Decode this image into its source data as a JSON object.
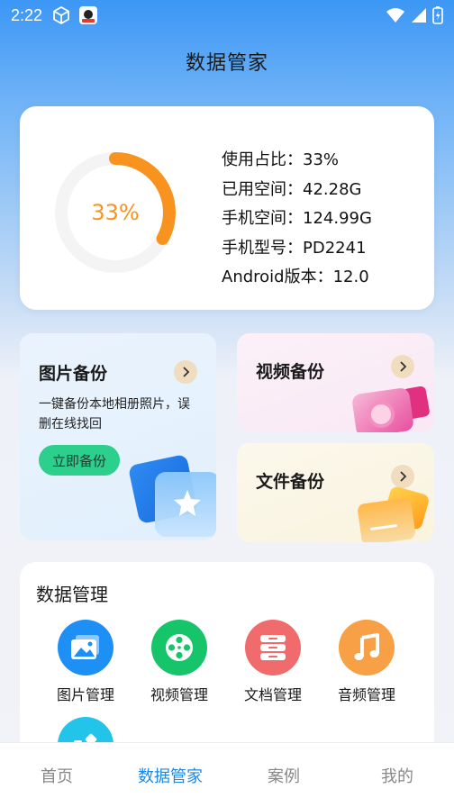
{
  "status_bar": {
    "time": "2:22"
  },
  "header": {
    "title": "数据管家"
  },
  "storage": {
    "percent_label": "33%",
    "percent_value": 0.33,
    "accent_color": "#f7931e",
    "lines": [
      "使用占比：33%",
      "已用空间：42.28G",
      "手机空间：124.99G",
      "手机型号：PD2241",
      "Android版本：12.0"
    ]
  },
  "backup": {
    "photo": {
      "title": "图片备份",
      "desc": "一键备份本地相册照片，误删在线找回",
      "button": "立即备份"
    },
    "video": {
      "title": "视频备份"
    },
    "file": {
      "title": "文件备份"
    }
  },
  "manage": {
    "title": "数据管理",
    "items": [
      {
        "label": "图片管理",
        "icon": "image-icon",
        "color": "#1e90f5"
      },
      {
        "label": "视频管理",
        "icon": "film-reel-icon",
        "color": "#16c46a"
      },
      {
        "label": "文档管理",
        "icon": "cabinet-icon",
        "color": "#f06b6b"
      },
      {
        "label": "音频管理",
        "icon": "music-note-icon",
        "color": "#f7a045"
      },
      {
        "label": "",
        "icon": "apps-icon",
        "color": "#22c4ea"
      }
    ]
  },
  "tabbar": {
    "tabs": [
      "首页",
      "数据管家",
      "案例",
      "我的"
    ],
    "active_index": 1
  }
}
